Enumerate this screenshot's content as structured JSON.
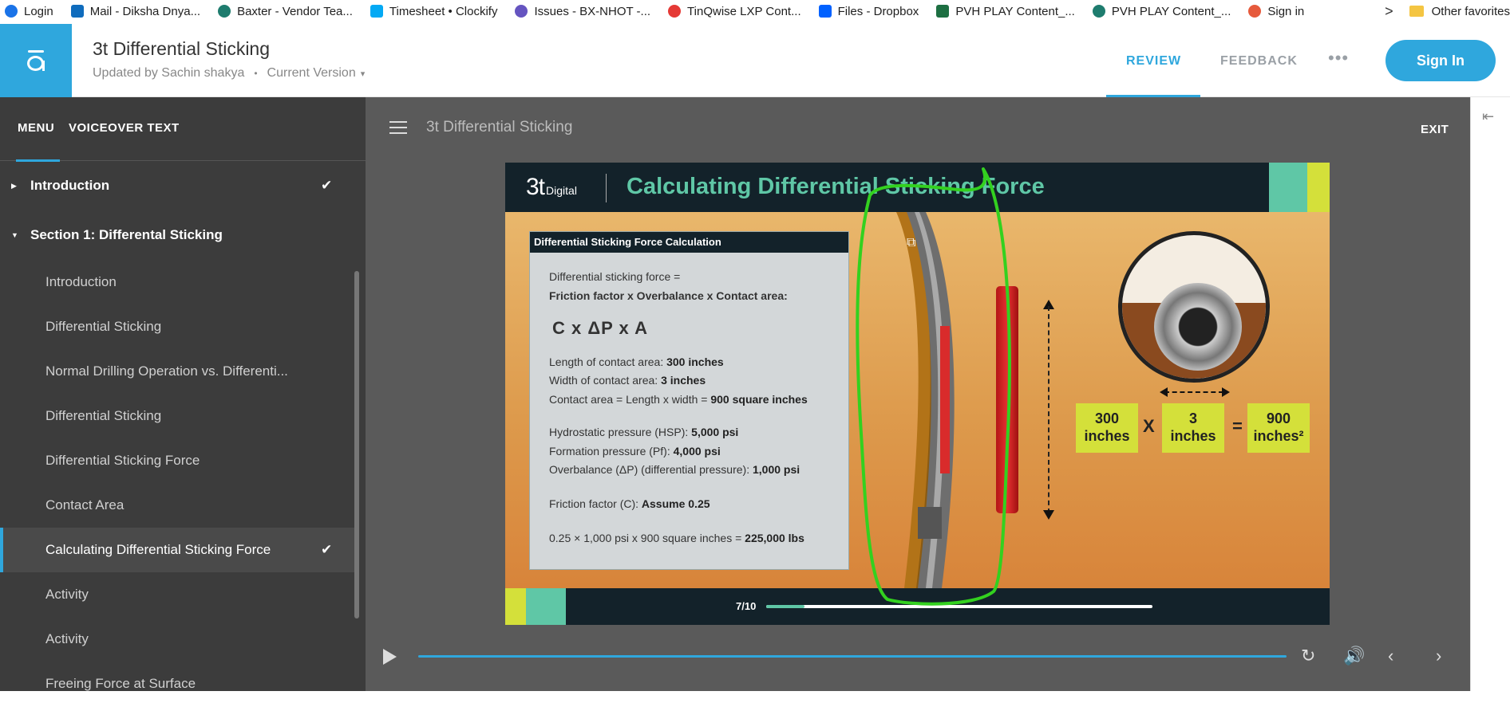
{
  "bookmarks": [
    {
      "label": "Login",
      "color": "#1a73e8"
    },
    {
      "label": "Mail - Diksha Dnya...",
      "color": "#0f6cbd"
    },
    {
      "label": "Baxter - Vendor Tea...",
      "color": "#1e7c6e"
    },
    {
      "label": "Timesheet • Clockify",
      "color": "#03a9f4"
    },
    {
      "label": "Issues - BX-NHOT -...",
      "color": "#6554c0"
    },
    {
      "label": "TinQwise LXP Cont...",
      "color": "#e53935"
    },
    {
      "label": "Files - Dropbox",
      "color": "#0061ff"
    },
    {
      "label": "PVH PLAY Content_...",
      "color": "#1d6f42"
    },
    {
      "label": "PVH PLAY Content_...",
      "color": "#1e7c6e"
    },
    {
      "label": "Sign in",
      "color": "#e65a3c"
    }
  ],
  "bookmarks_more": ">",
  "bookmarks_other": "Other favorites",
  "header": {
    "title": "3t Differential Sticking",
    "updated_by": "Updated by Sachin shakya",
    "separator": "•",
    "version": "Current Version",
    "nav": {
      "review": "REVIEW",
      "feedback": "FEEDBACK",
      "more": "•••"
    },
    "sign_in": "Sign In",
    "brand_color": "#2fa7dd"
  },
  "sidebar": {
    "tabs": {
      "menu": "MENU",
      "voiceover": "VOICEOVER TEXT"
    },
    "items": [
      {
        "label": "Introduction",
        "type": "section",
        "expanded": false,
        "completed": true
      },
      {
        "label": "Section 1: Differental Sticking",
        "type": "section",
        "expanded": true,
        "completed": false
      },
      {
        "label": "Introduction",
        "type": "lesson",
        "completed": false
      },
      {
        "label": "Differential Sticking",
        "type": "lesson",
        "completed": false
      },
      {
        "label": "Normal Drilling Operation vs. Differenti...",
        "type": "lesson",
        "completed": false
      },
      {
        "label": "Differential Sticking",
        "type": "lesson",
        "completed": false
      },
      {
        "label": "Differential Sticking Force",
        "type": "lesson",
        "completed": false
      },
      {
        "label": "Contact Area",
        "type": "lesson",
        "completed": false
      },
      {
        "label": "Calculating Differential Sticking Force",
        "type": "lesson",
        "completed": true,
        "active": true
      },
      {
        "label": "Activity",
        "type": "lesson",
        "completed": false
      },
      {
        "label": "Activity",
        "type": "lesson",
        "completed": false
      },
      {
        "label": "Freeing Force at Surface",
        "type": "lesson",
        "completed": false
      }
    ],
    "check_glyph": "✔"
  },
  "player": {
    "title": "3t Differential Sticking",
    "exit": "EXIT",
    "progress": 1.0
  },
  "slide": {
    "logo_main": "3t",
    "logo_sub": "Digital",
    "title": "Calculating Differential Sticking Force",
    "card_title": "Differential Sticking Force Calculation",
    "line1": "Differential sticking force =",
    "line2": "Friction factor x Overbalance x Contact area:",
    "formula": "C x ΔP x A",
    "length_label": "Length of contact area: ",
    "length_value": "300 inches",
    "width_label": "Width of contact area: ",
    "width_value": "3 inches",
    "area_label": " Contact area = Length x width = ",
    "area_value": "900 square inches",
    "hsp_label": "Hydrostatic pressure (HSP): ",
    "hsp_value": "5,000 psi",
    "pf_label": "Formation pressure (Pf): ",
    "pf_value": "4,000 psi",
    "ob_label": "Overbalance (ΔP) (differential pressure): ",
    "ob_value": "1,000 psi",
    "ff_label": "Friction factor (C): ",
    "ff_value": "Assume 0.25",
    "result_label": "0.25 × 1,000 psi x 900 square inches = ",
    "result_value": "225,000 lbs",
    "box1_num": "300",
    "box1_unit": "inches",
    "op_times": "X",
    "box2_num": "3",
    "box2_unit": "inches",
    "op_equals": "=",
    "box3_num": "900",
    "box3_unit": "inches²",
    "page": "7/10",
    "page_progress": 0.1,
    "colors": {
      "teal": "#5fc7a6",
      "lime": "#d4e03a",
      "navy": "#13222a"
    }
  }
}
